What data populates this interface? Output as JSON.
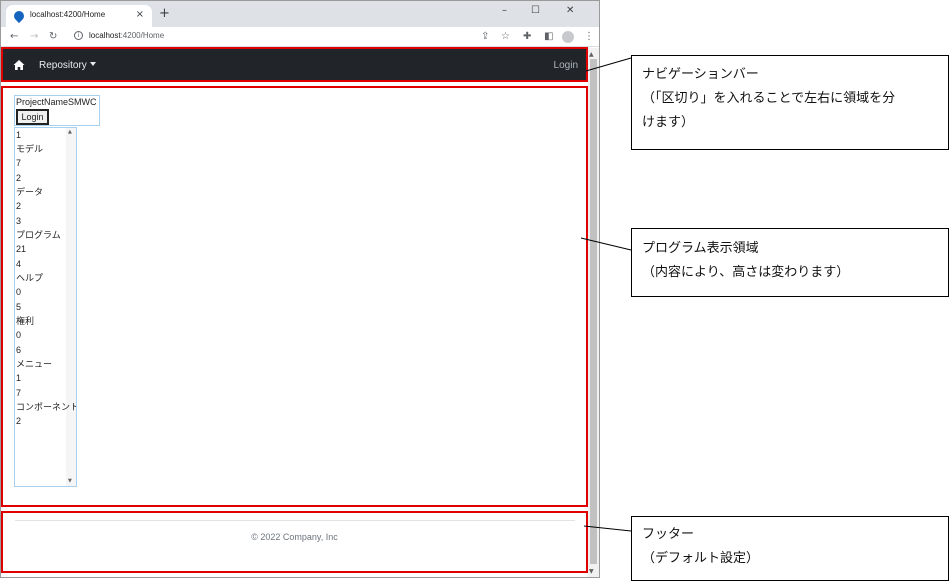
{
  "browser": {
    "tab_title": "localhost:4200/Home",
    "tab_close": "×",
    "new_tab": "+",
    "window_controls": {
      "minimize": "–",
      "maximize": "☐",
      "close": "✕"
    },
    "nav": {
      "back": "←",
      "forward": "→",
      "reload": "↻"
    },
    "url_host": "localhost",
    "url_rest": ":4200/Home",
    "icons": [
      "share-icon",
      "star-icon",
      "puzzle-icon",
      "sidepanel-icon",
      "profile-icon",
      "menu-icon"
    ]
  },
  "navbar": {
    "brand_icon": "home-icon",
    "repository_label": "Repository",
    "login_label": "Login"
  },
  "program": {
    "project_name": "ProjectNameSMWC",
    "login_button": "Login",
    "list_lines": [
      "1",
      "モデル",
      "7",
      "2",
      "データ",
      "2",
      "3",
      "プログラム",
      "21",
      "4",
      "ヘルプ",
      "0",
      "5",
      "権利",
      "0",
      "6",
      "メニュー",
      "1",
      "7",
      "コンポーネント",
      "2"
    ]
  },
  "footer": {
    "copyright": "© 2022 Company, Inc"
  },
  "callouts": [
    {
      "lines": [
        "ナビゲーションバー",
        "（「区切り」を入れることで左右に領域を分",
        "けます）"
      ]
    },
    {
      "lines": [
        "プログラム表示領域",
        "（内容により、高さは変わります）"
      ]
    },
    {
      "lines": [
        "フッター",
        "（デフォルト設定）"
      ]
    }
  ],
  "colors": {
    "navbar_bg": "#212529",
    "highlight": "#e00000",
    "listbox_border": "#a8d1f0"
  }
}
